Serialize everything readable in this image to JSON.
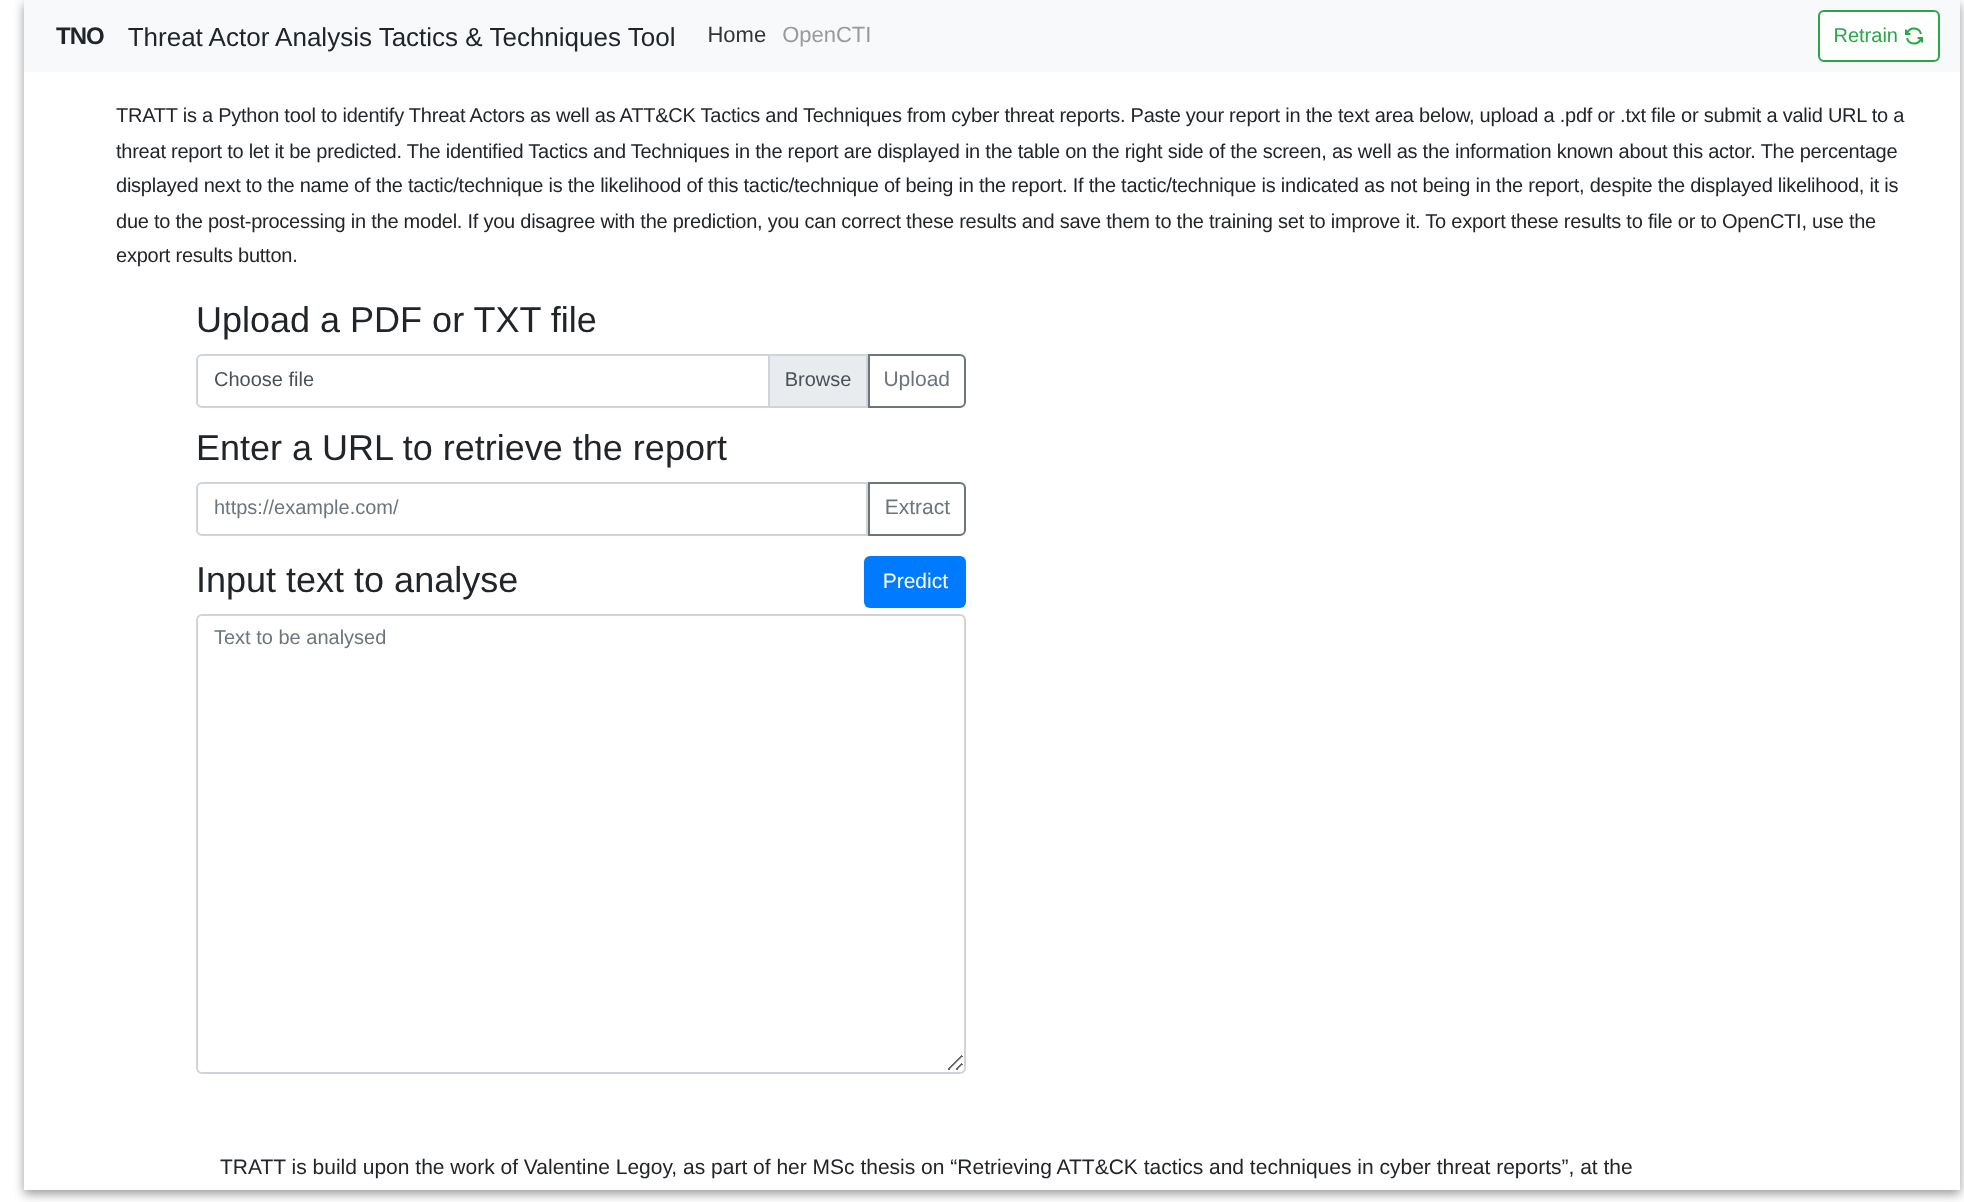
{
  "navbar": {
    "logo": "TNO",
    "title": "Threat Actor Analysis Tactics & Techniques Tool",
    "links": [
      {
        "label": "Home",
        "selected": true
      },
      {
        "label": "OpenCTI",
        "selected": false
      }
    ],
    "retrain_button": "Retrain"
  },
  "intro": "TRATT is a Python tool to identify Threat Actors as well as ATT&CK Tactics and Techniques from cyber threat reports. Paste your report in the text area below, upload a .pdf or .txt file or submit a valid URL to a threat report to let it be predicted. The identified Tactics and Techniques in the report are displayed in the table on the right side of the screen, as well as the information known about this actor. The percentage displayed next to the name of the tactic/technique is the likelihood of this tactic/technique of being in the report. If the tactic/technique is indicated as not being in the report, despite the displayed likelihood, it is due to the post-processing in the model. If you disagree with the prediction, you can correct these results and save them to the training set to improve it. To export these results to file or to OpenCTI, use the export results button.",
  "upload": {
    "heading": "Upload a PDF or TXT file",
    "placeholder": "Choose file",
    "browse": "Browse",
    "button": "Upload"
  },
  "url": {
    "heading": "Enter a URL to retrieve the report",
    "placeholder": "https://example.com/",
    "button": "Extract"
  },
  "text_input": {
    "heading": "Input text to analyse",
    "button": "Predict",
    "placeholder": "Text to be analysed"
  },
  "footer_text": "TRATT is build upon the work of Valentine Legoy, as part of her MSc thesis on “Retrieving ATT&CK tactics and techniques in cyber threat reports”, at the"
}
